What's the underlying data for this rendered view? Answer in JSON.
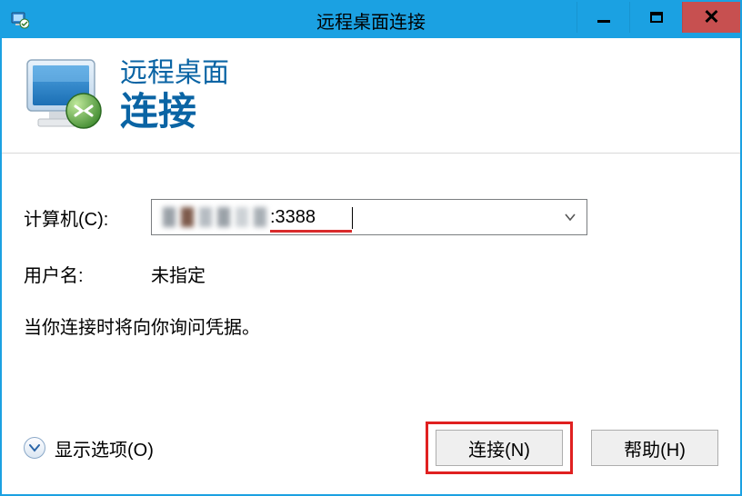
{
  "titlebar": {
    "title": "远程桌面连接"
  },
  "header": {
    "line1": "远程桌面",
    "line2": "连接"
  },
  "form": {
    "computer_label": "计算机(C):",
    "computer_value": ":3388",
    "username_label": "用户名:",
    "username_value": "未指定"
  },
  "hint": "当你连接时将向你询问凭据。",
  "footer": {
    "options_label": "显示选项(O)",
    "connect_label": "连接(N)",
    "help_label": "帮助(H)"
  }
}
